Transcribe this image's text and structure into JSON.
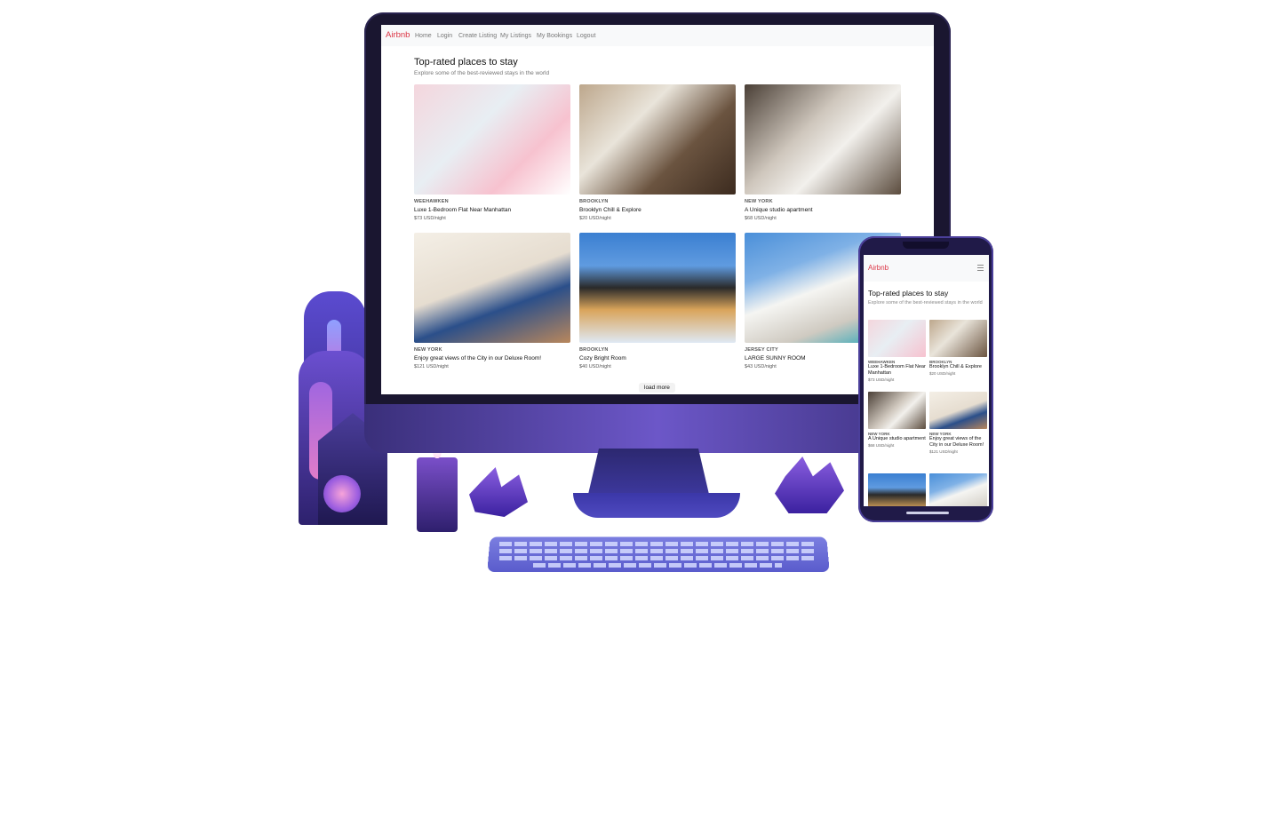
{
  "desktop": {
    "brand": "Airbnb",
    "nav": [
      "Home",
      "Login",
      "Create Listing",
      "My Listings",
      "My Bookings",
      "Logout"
    ],
    "heading": "Top-rated places to stay",
    "subheading": "Explore some of the best-reviewed stays in the world",
    "listings": [
      {
        "location": "WEEHAWKEN",
        "name": "Luxe 1-Bedroom Flat Near Manhattan",
        "price": "$73 USD/night"
      },
      {
        "location": "BROOKLYN",
        "name": "Brooklyn Chill & Explore",
        "price": "$20 USD/night"
      },
      {
        "location": "NEW YORK",
        "name": "A Unique studio apartment",
        "price": "$68 USD/night"
      },
      {
        "location": "NEW YORK",
        "name": "Enjoy great views of the City in our Deluxe Room!",
        "price": "$121 USD/night"
      },
      {
        "location": "BROOKLYN",
        "name": "Cozy Bright Room",
        "price": "$40 USD/night"
      },
      {
        "location": "JERSEY CITY",
        "name": "LARGE SUNNY ROOM",
        "price": "$43 USD/night"
      }
    ],
    "load_more": "load more"
  },
  "mobile": {
    "brand": "Airbnb",
    "heading": "Top-rated places to stay",
    "subheading": "Explore some of the best-reviewed stays in the world",
    "listings": [
      {
        "location": "WEEHAWKEN",
        "name": "Luxe 1-Bedroom Flat Near Manhattan",
        "price": "$73 USD/night"
      },
      {
        "location": "BROOKLYN",
        "name": "Brooklyn Chill & Explore",
        "price": "$20 USD/night"
      },
      {
        "location": "NEW YORK",
        "name": "A Unique studio apartment",
        "price": "$68 USD/night"
      },
      {
        "location": "NEW YORK",
        "name": "Enjoy great views of the City in our Deluxe Room!",
        "price": "$121 USD/night"
      }
    ],
    "menu_icon": "hamburger-icon"
  },
  "colors": {
    "brand": "#dc3545",
    "device_accent": "#5b4bd0"
  }
}
